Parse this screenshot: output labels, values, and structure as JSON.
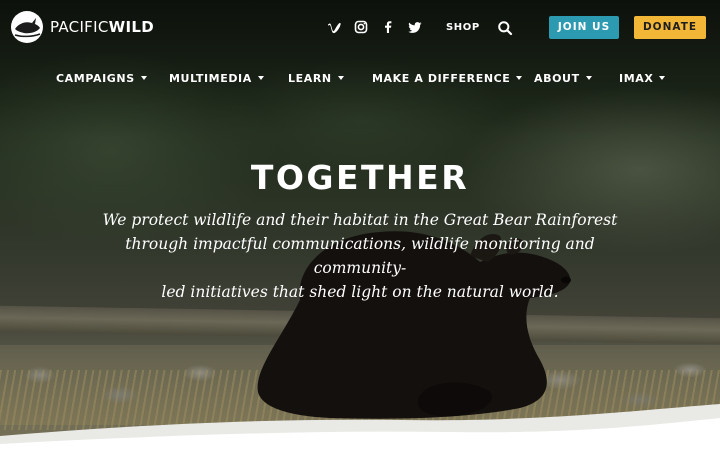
{
  "brand": {
    "name_light": "PACIFIC",
    "name_bold": "WILD"
  },
  "social": [
    {
      "name": "vimeo",
      "icon": "vimeo-icon"
    },
    {
      "name": "instagram",
      "icon": "instagram-icon"
    },
    {
      "name": "facebook",
      "icon": "facebook-icon"
    },
    {
      "name": "twitter",
      "icon": "twitter-icon"
    }
  ],
  "header": {
    "shop_label": "SHOP",
    "join_label": "JOIN US",
    "donate_label": "DONATE"
  },
  "nav": {
    "items": [
      {
        "label": "CAMPAIGNS"
      },
      {
        "label": "MULTIMEDIA"
      },
      {
        "label": "LEARN"
      },
      {
        "label": "MAKE A DIFFERENCE"
      },
      {
        "label": "ABOUT"
      },
      {
        "label": "IMAX"
      }
    ]
  },
  "hero": {
    "headline": "TOGETHER",
    "tagline_line1": "We protect wildlife and their habitat in the Great Bear Rainforest",
    "tagline_line2": "through impactful communications, wildlife monitoring and community-",
    "tagline_line3": "led initiatives that shed light on the natural world."
  },
  "colors": {
    "join": "#2c9bb2",
    "donate": "#f2b736"
  }
}
